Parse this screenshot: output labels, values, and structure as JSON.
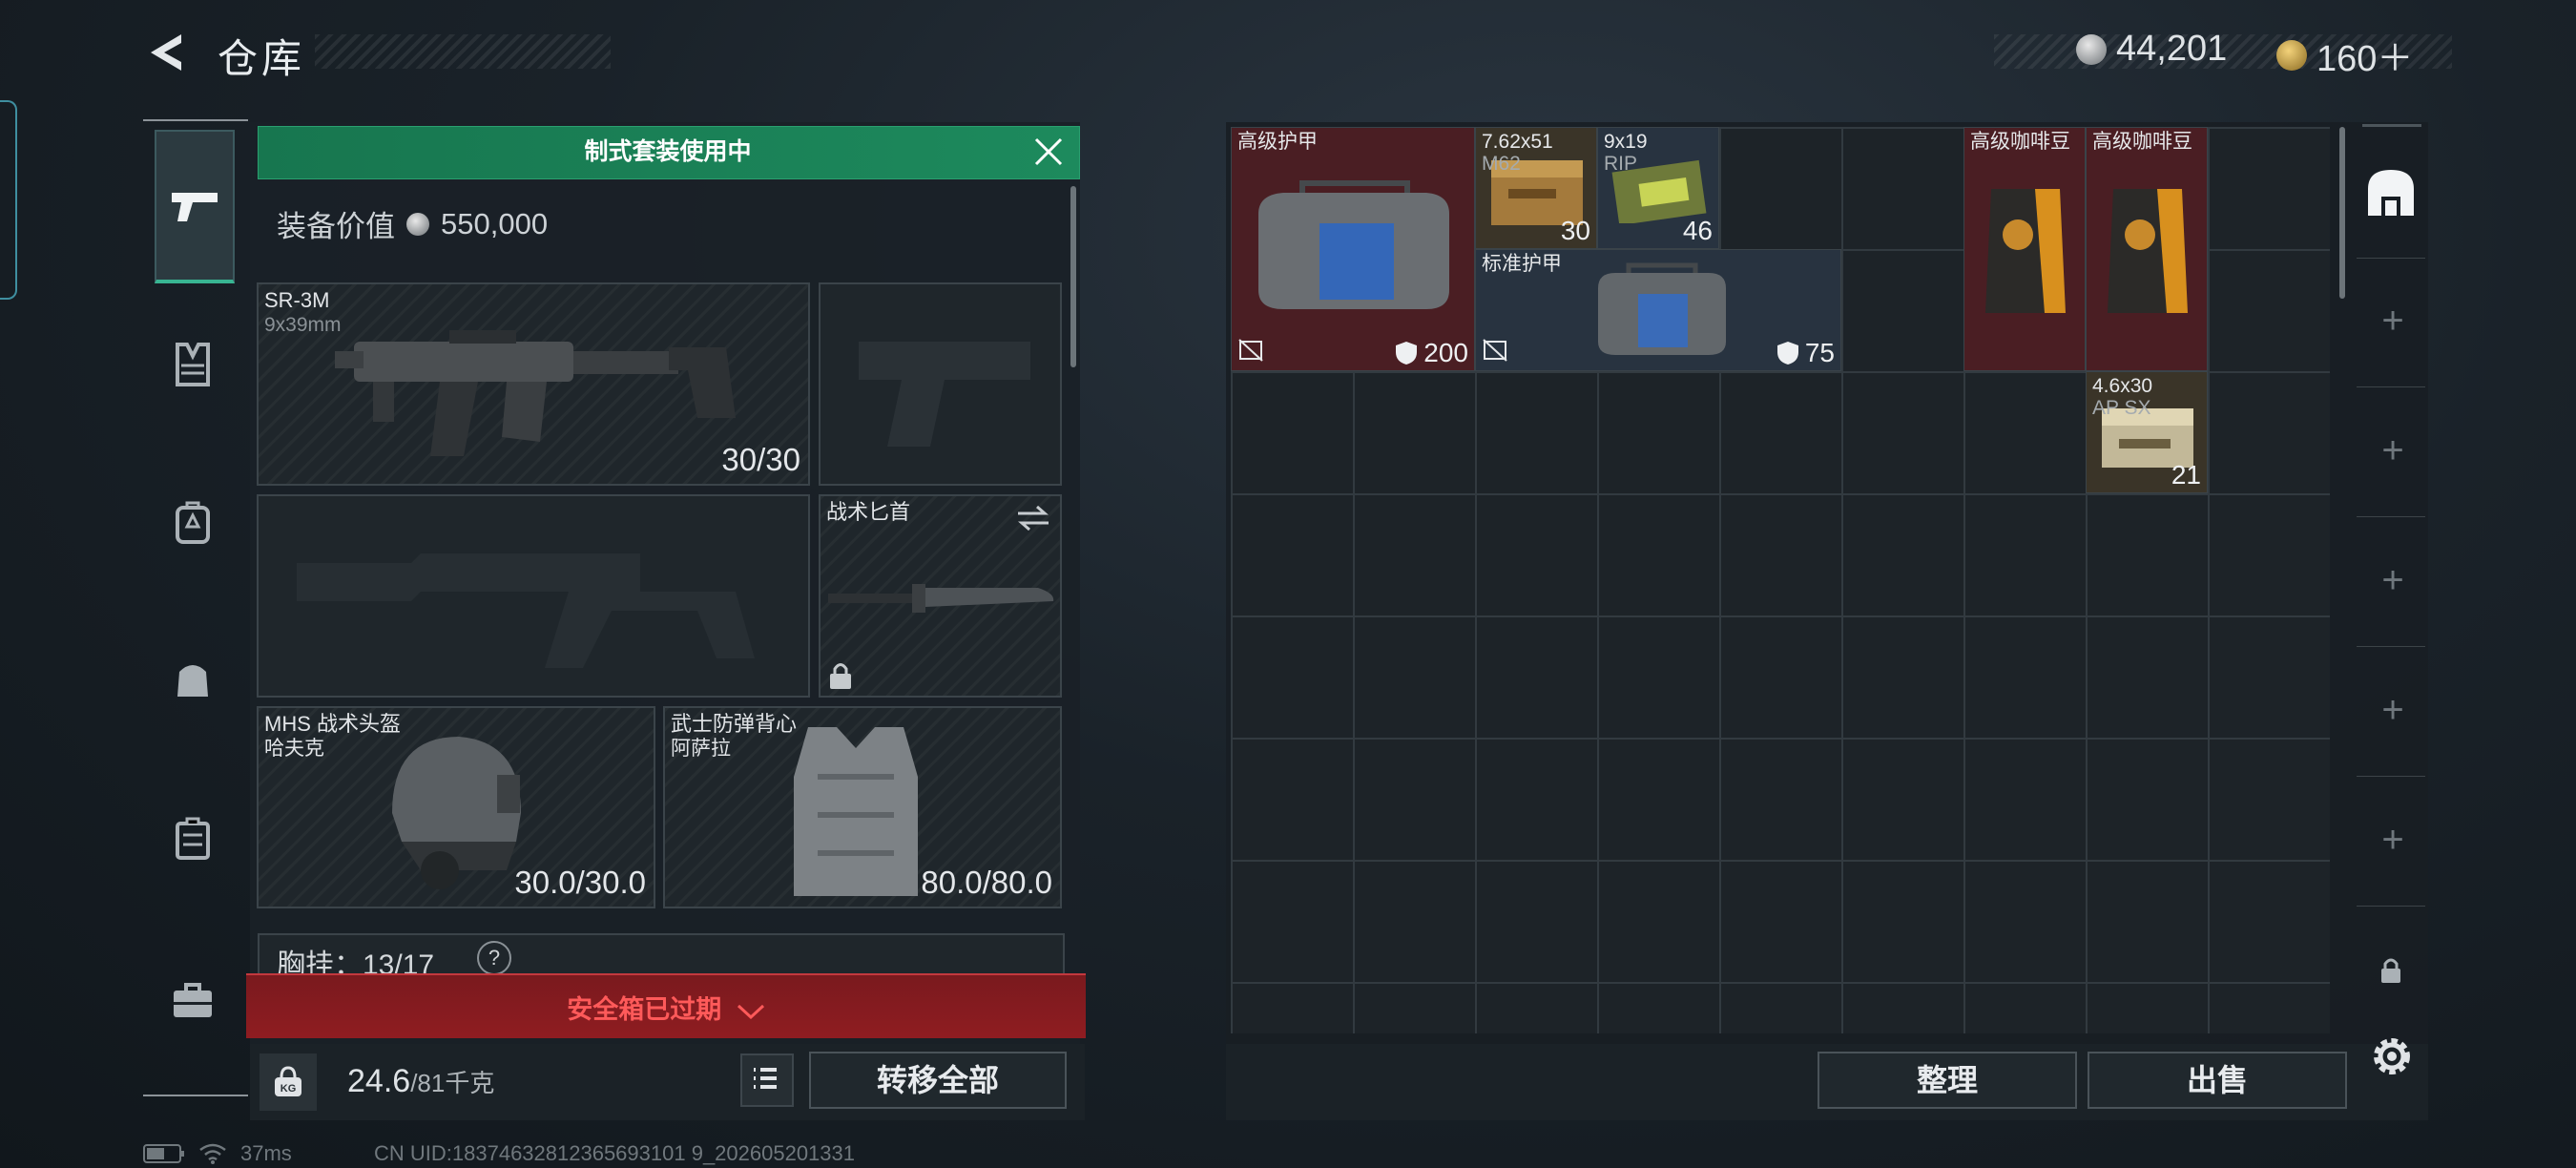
{
  "header": {
    "title": "仓库",
    "currency_silver": "44,201",
    "currency_gold": "160＋"
  },
  "left_tabs": [
    "pistol-icon",
    "chest-rig-icon",
    "backpack-icon",
    "bag-icon",
    "case-icon",
    "toolbox-icon"
  ],
  "equipment": {
    "suit_banner": "制式套装使用中",
    "value_label": "装备价值",
    "value": "550,000",
    "primary": {
      "name": "SR-3M",
      "caliber": "9x39mm",
      "ammo": "30/30"
    },
    "melee": {
      "name": "战术匕首"
    },
    "helmet": {
      "name": "MHS 战术头盔",
      "sub": "哈夫克",
      "durability": "30.0/30.0"
    },
    "armor": {
      "name": "武士防弹背心",
      "sub": "阿萨拉",
      "durability": "80.0/80.0"
    },
    "chest_rig": {
      "label": "胸挂：",
      "value": "13/17",
      "help": "?"
    },
    "safe_box": "安全箱已过期",
    "weight": "24.6",
    "weight_max": "/81千克",
    "kg_badge": "KG",
    "transfer_all": "转移全部"
  },
  "grid": {
    "items": [
      {
        "name": "高级护甲",
        "value": "200"
      },
      {
        "name": "7.62x51",
        "sub": "M62",
        "count": "30"
      },
      {
        "name": "9x19",
        "sub": "RIP",
        "count": "46"
      },
      {
        "name": "标准护甲",
        "value": "75"
      },
      {
        "name": "高级咖啡豆"
      },
      {
        "name": "高级咖啡豆"
      },
      {
        "name": "4.6x30",
        "sub": "AP SX",
        "count": "21"
      }
    ],
    "sort": "整理",
    "sell": "出售"
  },
  "status": {
    "ping": "37ms",
    "uid": "CN UID:18374632812365693101 9_202605201331"
  }
}
